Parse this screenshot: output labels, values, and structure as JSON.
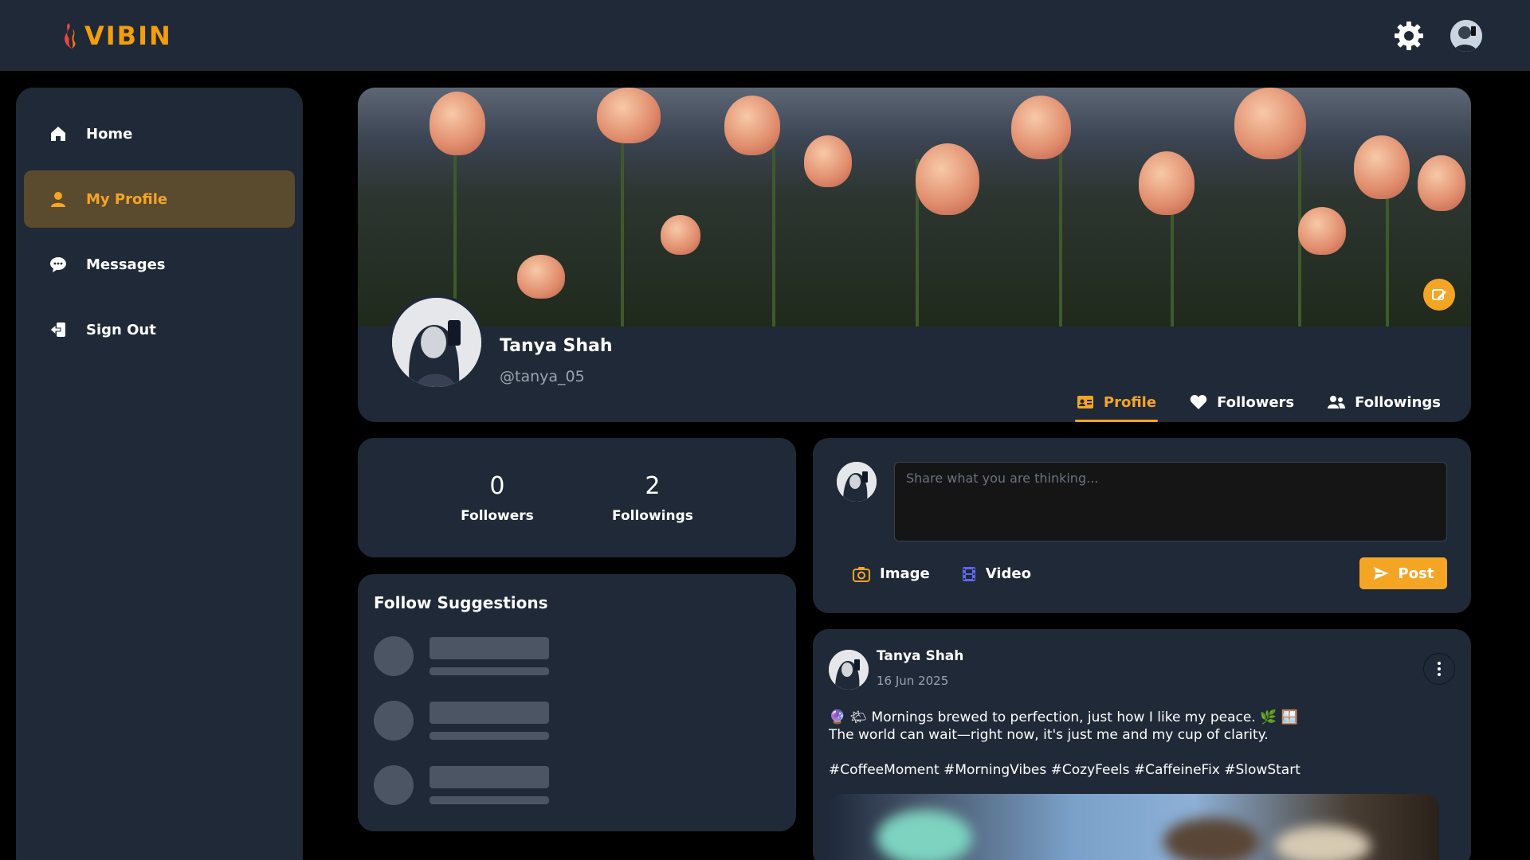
{
  "app": {
    "logo_text": "VIBIN",
    "accent_color": "#f5a524"
  },
  "topbar": {
    "settings_icon": "gear-icon",
    "avatar": "user-avatar"
  },
  "sidebar": {
    "items": [
      {
        "label": "Home",
        "icon": "home-icon",
        "active": false
      },
      {
        "label": "My Profile",
        "icon": "user-icon",
        "active": true
      },
      {
        "label": "Messages",
        "icon": "chat-icon",
        "active": false
      },
      {
        "label": "Sign Out",
        "icon": "sign-out-icon",
        "active": false
      }
    ]
  },
  "profile": {
    "name": "Tanya Shah",
    "handle": "@tanya_05",
    "tabs": [
      {
        "label": "Profile",
        "icon": "id-card-icon",
        "active": true
      },
      {
        "label": "Followers",
        "icon": "heart-icon",
        "active": false
      },
      {
        "label": "Followings",
        "icon": "users-icon",
        "active": false
      }
    ]
  },
  "stats": {
    "followers_count": "0",
    "followers_label": "Followers",
    "followings_count": "2",
    "followings_label": "Followings"
  },
  "suggestions": {
    "title": "Follow Suggestions"
  },
  "composer": {
    "placeholder": "Share what you are thinking...",
    "image_label": "Image",
    "video_label": "Video",
    "post_label": "Post"
  },
  "post": {
    "author": "Tanya Shah",
    "date": "16 Jun 2025",
    "line1": "🔮 🌤 Mornings brewed to perfection, just how I like my peace. 🌿 🪟",
    "line2": "The world can wait—right now, it's just me and my cup of clarity.",
    "tags": "#CoffeeMoment #MorningVibes #CozyFeels #CaffeineFix #SlowStart"
  }
}
